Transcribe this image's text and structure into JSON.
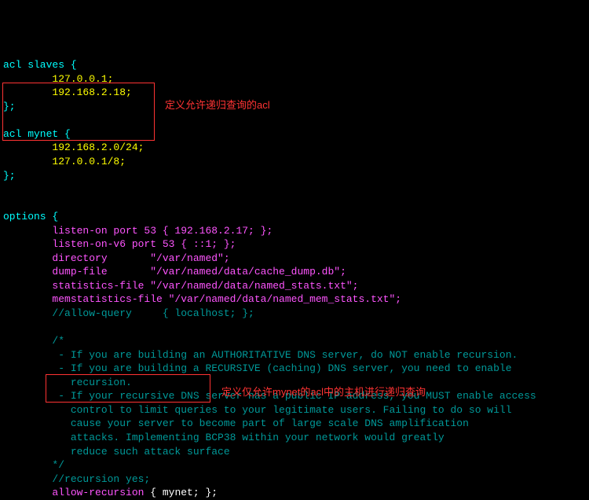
{
  "acl_slaves": {
    "decl": "acl slaves {",
    "entry1": "127.0.0.1;",
    "entry2": "192.168.2.18;",
    "close": "};"
  },
  "acl_mynet": {
    "decl": "acl mynet {",
    "entry1": "192.168.2.0/24;",
    "entry2": "127.0.0.1/8;",
    "close": "};",
    "annotation": "定义允许递归查询的acl"
  },
  "options": {
    "decl": "options {",
    "listen_on": "        listen-on port 53 { 192.168.2.17; };",
    "listen_on_v6": "        listen-on-v6 port 53 { ::1; };",
    "directory": "        directory       \"/var/named\";",
    "dump_file": "        dump-file       \"/var/named/data/cache_dump.db\";",
    "statistics": "        statistics-file \"/var/named/data/named_stats.txt\";",
    "memstatistics": "        memstatistics-file \"/var/named/data/named_mem_stats.txt\";",
    "allow_query": "        //allow-query     { localhost; };",
    "comment_open": "        /*",
    "c1": "         - If you are building an AUTHORITATIVE DNS server, do NOT enable recursion.",
    "c2": "         - If you are building a RECURSIVE (caching) DNS server, you need to enable",
    "c3": "           recursion.",
    "c4": "         - If your recursive DNS server has a public IP address, you MUST enable access",
    "c5": "           control to limit queries to your legitimate users. Failing to do so will",
    "c6": "           cause your server to become part of large scale DNS amplification",
    "c7": "           attacks. Implementing BCP38 within your network would greatly",
    "c8": "           reduce such attack surface",
    "comment_close": "        */",
    "recursion_yes": "        //recursion yes;",
    "allow_recursion_key": "allow-recursion",
    "allow_recursion_val": " { mynet; };",
    "annotation2": "定义仅允许mynet的acl中的主机进行递归查询"
  }
}
